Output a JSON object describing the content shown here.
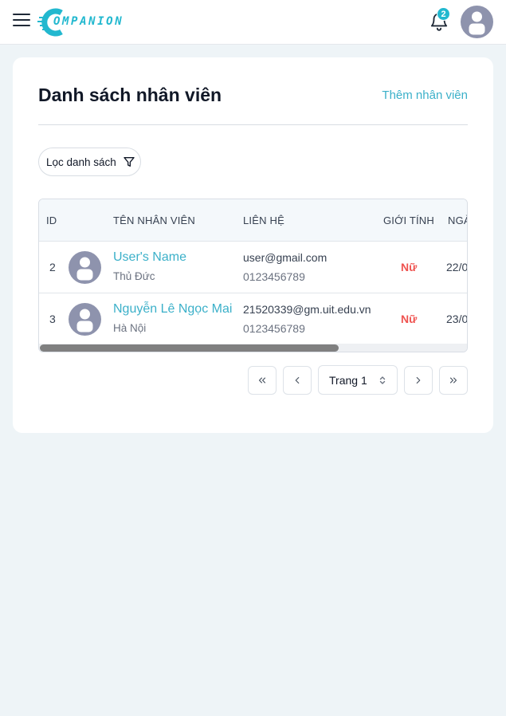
{
  "app": {
    "logo_text": "OMPANION",
    "notification_count": "2",
    "colors": {
      "accent": "#22b8cf",
      "link": "#3bb0c9",
      "female": "#ef5350",
      "background": "#eef4f7"
    },
    "icons": {
      "menu": "hamburger-icon",
      "bell": "bell-icon",
      "avatar": "user-avatar-icon",
      "filter": "funnel-icon"
    }
  },
  "page": {
    "title": "Danh sách nhân viên",
    "add_link": "Thêm nhân viên",
    "filter_label": "Lọc danh sách"
  },
  "table": {
    "headers": {
      "id": "ID",
      "name": "TÊN NHÂN VIÊN",
      "contact": "LIÊN HỆ",
      "gender": "GIỚI TÍNH",
      "date": "NGÀ"
    },
    "rows": [
      {
        "id": "2",
        "name": "User's Name",
        "city": "Thủ Đức",
        "email": "user@gmail.com",
        "phone": "0123456789",
        "gender": "Nữ",
        "date": "22/0"
      },
      {
        "id": "3",
        "name": "Nguyễn Lê Ngọc Mai",
        "city": "Hà Nội",
        "email": "21520339@gm.uit.edu.vn",
        "phone": "0123456789",
        "gender": "Nữ",
        "date": "23/0"
      }
    ]
  },
  "pagination": {
    "current_page": "Trang 1"
  }
}
